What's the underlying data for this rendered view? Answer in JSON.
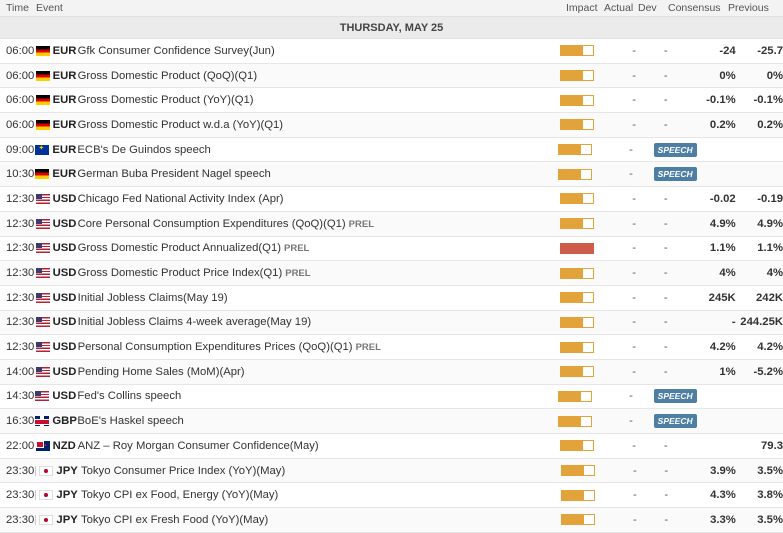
{
  "header": {
    "time": "Time",
    "event": "Event",
    "impact": "Impact",
    "actual": "Actual",
    "dev": "Dev",
    "consensus": "Consensus",
    "previous": "Previous"
  },
  "day_label": "THURSDAY, MAY 25",
  "colors": {
    "impact_medium": "#e2a33a",
    "impact_high": "#cd5c4b",
    "speech_badge": "#4d7ea3"
  },
  "events": [
    {
      "time": "06:00",
      "flag": "de",
      "currency": "EUR",
      "name": "Gfk Consumer Confidence Survey(Jun)",
      "tag": "",
      "impact": "medium",
      "actual": "-",
      "dev": "-",
      "consensus": "-24",
      "previous": "-25.7"
    },
    {
      "time": "06:00",
      "flag": "de",
      "currency": "EUR",
      "name": "Gross Domestic Product (QoQ)(Q1)",
      "tag": "",
      "impact": "medium",
      "actual": "-",
      "dev": "-",
      "consensus": "0%",
      "previous": "0%"
    },
    {
      "time": "06:00",
      "flag": "de",
      "currency": "EUR",
      "name": "Gross Domestic Product (YoY)(Q1)",
      "tag": "",
      "impact": "medium",
      "actual": "-",
      "dev": "-",
      "consensus": "-0.1%",
      "previous": "-0.1%"
    },
    {
      "time": "06:00",
      "flag": "de",
      "currency": "EUR",
      "name": "Gross Domestic Product w.d.a (YoY)(Q1)",
      "tag": "",
      "impact": "medium",
      "actual": "-",
      "dev": "-",
      "consensus": "0.2%",
      "previous": "0.2%"
    },
    {
      "time": "09:00",
      "flag": "eu",
      "currency": "EUR",
      "name": "ECB's De Guindos speech",
      "tag": "",
      "impact": "medium",
      "actual": "-",
      "dev": "",
      "consensus": "",
      "previous": "",
      "speech": "SPEECH"
    },
    {
      "time": "10:30",
      "flag": "de",
      "currency": "EUR",
      "name": "German Buba President Nagel speech",
      "tag": "",
      "impact": "medium",
      "actual": "-",
      "dev": "",
      "consensus": "",
      "previous": "",
      "speech": "SPEECH"
    },
    {
      "time": "12:30",
      "flag": "us",
      "currency": "USD",
      "name": "Chicago Fed National Activity Index (Apr)",
      "tag": "",
      "impact": "medium",
      "actual": "-",
      "dev": "-",
      "consensus": "-0.02",
      "previous": "-0.19"
    },
    {
      "time": "12:30",
      "flag": "us",
      "currency": "USD",
      "name": "Core Personal Consumption Expenditures (QoQ)(Q1)",
      "tag": "PREL",
      "impact": "medium",
      "actual": "-",
      "dev": "-",
      "consensus": "4.9%",
      "previous": "4.9%"
    },
    {
      "time": "12:30",
      "flag": "us",
      "currency": "USD",
      "name": "Gross Domestic Product Annualized(Q1)",
      "tag": "PREL",
      "impact": "high",
      "actual": "-",
      "dev": "-",
      "consensus": "1.1%",
      "previous": "1.1%"
    },
    {
      "time": "12:30",
      "flag": "us",
      "currency": "USD",
      "name": "Gross Domestic Product Price Index(Q1)",
      "tag": "PREL",
      "impact": "medium",
      "actual": "-",
      "dev": "-",
      "consensus": "4%",
      "previous": "4%"
    },
    {
      "time": "12:30",
      "flag": "us",
      "currency": "USD",
      "name": "Initial Jobless Claims(May 19)",
      "tag": "",
      "impact": "medium",
      "actual": "-",
      "dev": "-",
      "consensus": "245K",
      "previous": "242K"
    },
    {
      "time": "12:30",
      "flag": "us",
      "currency": "USD",
      "name": "Initial Jobless Claims 4-week average(May 19)",
      "tag": "",
      "impact": "medium",
      "actual": "-",
      "dev": "-",
      "consensus": "-",
      "previous": "244.25K"
    },
    {
      "time": "12:30",
      "flag": "us",
      "currency": "USD",
      "name": "Personal Consumption Expenditures Prices (QoQ)(Q1)",
      "tag": "PREL",
      "impact": "medium",
      "actual": "-",
      "dev": "-",
      "consensus": "4.2%",
      "previous": "4.2%"
    },
    {
      "time": "14:00",
      "flag": "us",
      "currency": "USD",
      "name": "Pending Home Sales (MoM)(Apr)",
      "tag": "",
      "impact": "medium",
      "actual": "-",
      "dev": "-",
      "consensus": "1%",
      "previous": "-5.2%"
    },
    {
      "time": "14:30",
      "flag": "us",
      "currency": "USD",
      "name": "Fed's Collins speech",
      "tag": "",
      "impact": "medium",
      "actual": "-",
      "dev": "",
      "consensus": "",
      "previous": "",
      "speech": "SPEECH"
    },
    {
      "time": "16:30",
      "flag": "gb",
      "currency": "GBP",
      "name": "BoE's Haskel speech",
      "tag": "",
      "impact": "medium",
      "actual": "-",
      "dev": "",
      "consensus": "",
      "previous": "",
      "speech": "SPEECH"
    },
    {
      "time": "22:00",
      "flag": "nz",
      "currency": "NZD",
      "name": "ANZ – Roy Morgan Consumer Confidence(May)",
      "tag": "",
      "impact": "medium",
      "actual": "-",
      "dev": "-",
      "consensus": "",
      "previous": "79.3"
    },
    {
      "time": "23:30",
      "flag": "jp",
      "currency": "JPY",
      "name": "Tokyo Consumer Price Index (YoY)(May)",
      "tag": "",
      "impact": "medium",
      "actual": "-",
      "dev": "-",
      "consensus": "3.9%",
      "previous": "3.5%"
    },
    {
      "time": "23:30",
      "flag": "jp",
      "currency": "JPY",
      "name": "Tokyo CPI ex Food, Energy (YoY)(May)",
      "tag": "",
      "impact": "medium",
      "actual": "-",
      "dev": "-",
      "consensus": "4.3%",
      "previous": "3.8%"
    },
    {
      "time": "23:30",
      "flag": "jp",
      "currency": "JPY",
      "name": "Tokyo CPI ex Fresh Food (YoY)(May)",
      "tag": "",
      "impact": "medium",
      "actual": "-",
      "dev": "-",
      "consensus": "3.3%",
      "previous": "3.5%"
    }
  ]
}
